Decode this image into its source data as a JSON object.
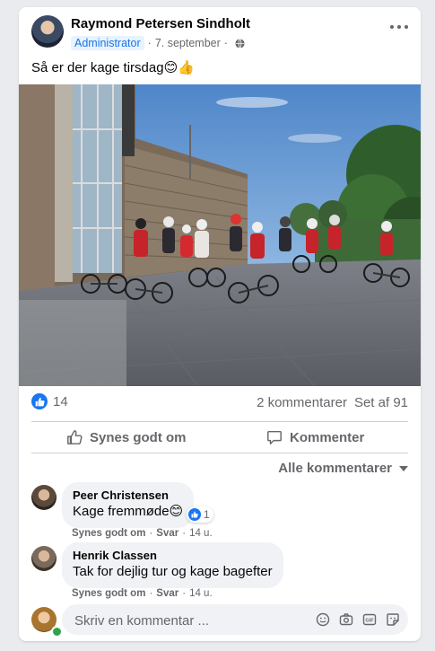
{
  "post": {
    "author": "Raymond Petersen Sindholt",
    "role_badge": "Administrator",
    "date": "7. september",
    "dot": "·",
    "text": "Så er der kage tirsdag😊👍",
    "privacy_icon": "globe-icon",
    "more_icon": "more-icon"
  },
  "reactions": {
    "like_count": "14",
    "comments": "2 kommentarer",
    "views": "Set af 91"
  },
  "actions": {
    "like_label": "Synes godt om",
    "comment_label": "Kommenter"
  },
  "comments_filter": "Alle kommentarer",
  "comments": [
    {
      "name": "Peer Christensen",
      "text": "Kage fremmøde😊",
      "like_label": "Synes godt om",
      "reply_label": "Svar",
      "age": "14 u.",
      "reaction_count": "1"
    },
    {
      "name": "Henrik Classen",
      "text": "Tak for dejlig tur og kage bagefter",
      "like_label": "Synes godt om",
      "reply_label": "Svar",
      "age": "14 u."
    }
  ],
  "composer": {
    "placeholder": "Skriv en kommentar ...",
    "icons": [
      "emoji-icon",
      "camera-icon",
      "gif-icon",
      "sticker-icon"
    ]
  },
  "colors": {
    "accent": "#1877f2",
    "badge_bg": "#e7f3ff",
    "muted_text": "#65676b",
    "bubble_bg": "#f0f2f5"
  }
}
